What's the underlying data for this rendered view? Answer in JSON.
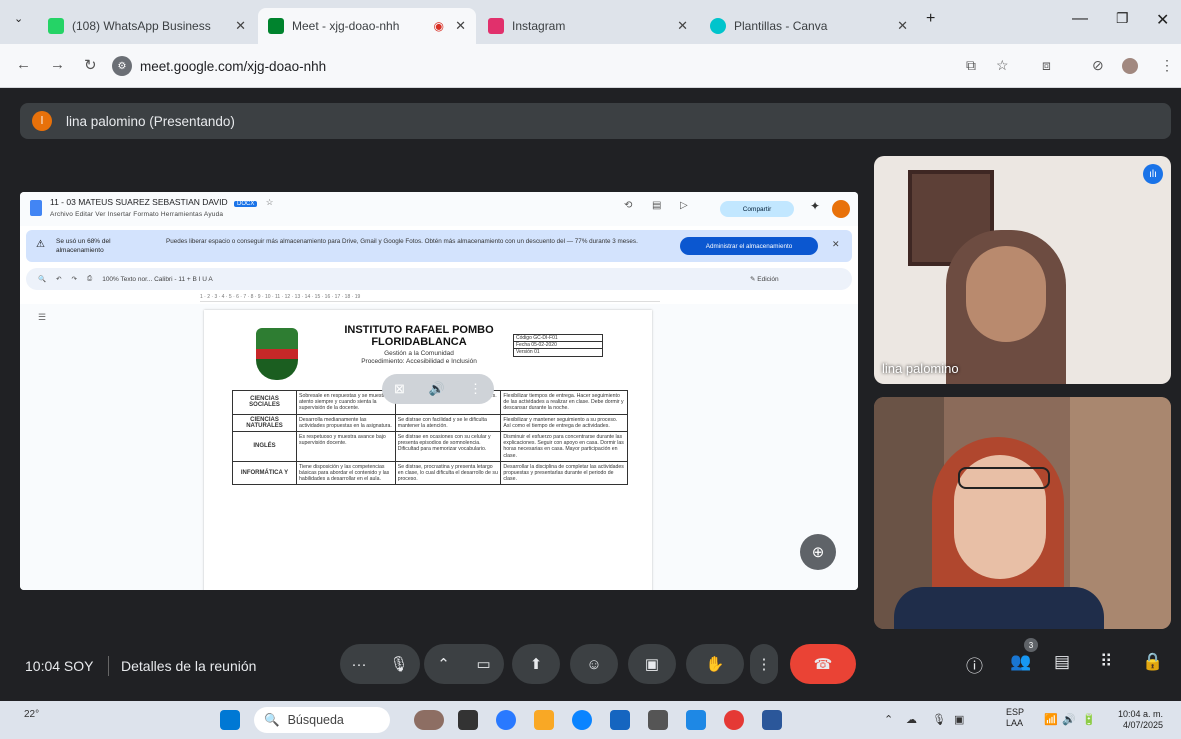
{
  "browser": {
    "tabs": [
      {
        "title": "(108) WhatsApp Business",
        "color": "#25d366"
      },
      {
        "title": "Meet - xjg-doao-nhh",
        "color": "#00832d"
      },
      {
        "title": "Instagram",
        "color": "#e1306c"
      },
      {
        "title": "Plantillas - Canva",
        "color": "#00c4cc"
      }
    ],
    "url": "meet.google.com/xjg-doao-nhh"
  },
  "meet": {
    "presenter_label": "lina palomino (Presentando)",
    "presenter_initial": "l",
    "participants": [
      {
        "name": "lina palomino"
      },
      {
        "name": ""
      }
    ],
    "clock": "10:04 SOY",
    "details_label": "Detalles de la reunión",
    "people_count": "3"
  },
  "doc": {
    "title": "11 - 03 MATEUS SUAREZ SEBASTIAN DAVID",
    "badge": "DOCX",
    "menu": "Archivo  Editar  Ver  Insertar  Formato  Herramientas  Ayuda",
    "share_label": "Compartir",
    "banner_title": "Se usó un 68% del almacenamiento",
    "banner_text": "Puedes liberar espacio o conseguir más almacenamiento para Drive, Gmail y Google Fotos. Obtén más almacenamiento con un descuento del — 77% durante 3 meses.",
    "banner_button": "Administrar el almacenamiento",
    "toolbar": "100%   Texto nor...   Calibri   -  11  +   B  I  U  A",
    "edit_mode": "Edición",
    "school": "INSTITUTO RAFAEL POMBO FLORIDABLANCA",
    "school_sub1": "Gestión a la Comunidad",
    "school_sub2": "Procedimiento: Accesibilidad e Inclusión",
    "meta": [
      "Código    GC-DI-F01",
      "Fecha     05-02-2020",
      "Versión       01"
    ],
    "rows": [
      {
        "subject": "CIENCIAS SOCIALES",
        "c1": "Sobresale en respuestas y se muestra atento siempre y cuando sienta la supervisión de la docente.",
        "c2": "Presenta las actividades correspondientes. A veces se distrae con su celular.",
        "c3": "Flexibilizar tiempos de entrega. Hacer seguimiento de las actividades a realizar en clase. Debe dormir y descansar durante la noche."
      },
      {
        "subject": "CIENCIAS NATURALES",
        "c1": "Desarrolla medianamente las actividades propuestas en la asignatura.",
        "c2": "Se distrae con facilidad y se le dificulta mantener la atención.",
        "c3": "Flexibilizar y mantener seguimiento a su proceso. Así como el tiempo de entrega de actividades."
      },
      {
        "subject": "INGLÉS",
        "c1": "Es respetuoso y muestra avance bajo supervisión docente.",
        "c2": "Se distrae en ocasiones con su celular y presenta episodios de somnolencia. Dificultad para memorizar vocabulario.",
        "c3": "Disminuir el esfuerzo para concentrarse durante las explicaciones. Seguir con apoyo en casa. Dormir las horas necesarias en casa. Mayor participación en clase."
      },
      {
        "subject": "INFORMÁTICA Y",
        "c1": "Tiene disposición y las competencias básicas para abordar el contenido y las habilidades a desarrollar en el aula.",
        "c2": "Se distrae, procrastina y presenta letargo en clase, lo cual dificulta el desarrollo de su proceso.",
        "c3": "Desarrollar la disciplina de completar las actividades propuestas y presentarlas durante el periodo de clase."
      }
    ]
  },
  "taskbar": {
    "weather": "22°",
    "search_placeholder": "Búsqueda",
    "lang1": "ESP",
    "lang2": "LAA",
    "time": "10:04 a. m.",
    "date": "4/07/2025"
  }
}
